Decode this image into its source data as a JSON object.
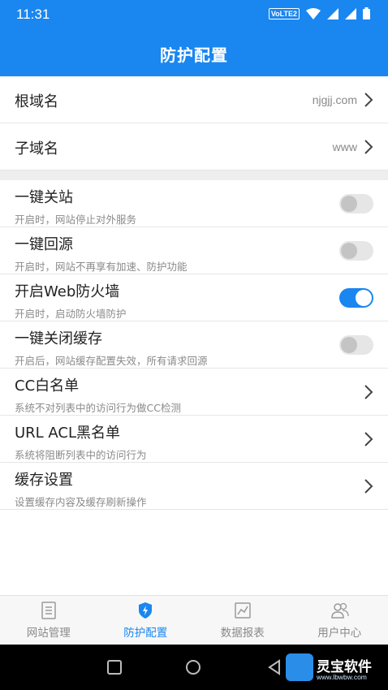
{
  "status_bar": {
    "time": "11:31",
    "network_badge": "VoLTE2",
    "icons": [
      "wifi-icon",
      "signal-icon",
      "signal-icon",
      "battery-icon"
    ]
  },
  "header": {
    "title": "防护配置",
    "background": "#1a86f0"
  },
  "domain_rows": [
    {
      "label": "根域名",
      "value": "njgjj.com"
    },
    {
      "label": "子域名",
      "value": "www"
    }
  ],
  "settings": [
    {
      "label": "一键关站",
      "desc": "开启时，网站停止对外服务",
      "control": "toggle",
      "on": false
    },
    {
      "label": "一键回源",
      "desc": "开启时，网站不再享有加速、防护功能",
      "control": "toggle",
      "on": false
    },
    {
      "label": "开启Web防火墙",
      "desc": "开启时，启动防火墙防护",
      "control": "toggle",
      "on": true
    },
    {
      "label": "一键关闭缓存",
      "desc": "开启后，网站缓存配置失效，所有请求回源",
      "control": "toggle",
      "on": false
    },
    {
      "label": "CC白名单",
      "desc": "系统不对列表中的访问行为做CC检测",
      "control": "chevron"
    },
    {
      "label": "URL ACL黑名单",
      "desc": "系统将阻断列表中的访问行为",
      "control": "chevron"
    },
    {
      "label": "缓存设置",
      "desc": "设置缓存内容及缓存刷新操作",
      "control": "chevron"
    }
  ],
  "tabs": [
    {
      "label": "网站管理",
      "icon": "document-icon",
      "active": false
    },
    {
      "label": "防护配置",
      "icon": "shield-icon",
      "active": true
    },
    {
      "label": "数据报表",
      "icon": "chart-icon",
      "active": false
    },
    {
      "label": "用户中心",
      "icon": "users-icon",
      "active": false
    }
  ],
  "watermark": {
    "name": "灵宝软件",
    "url": "www.lbwbw.com"
  },
  "colors": {
    "accent": "#1a86f0",
    "toggle_off": "#e6e6e6",
    "muted_text": "#8a8a8a"
  }
}
